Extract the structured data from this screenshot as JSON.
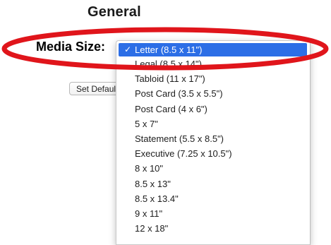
{
  "section": {
    "title": "General"
  },
  "field": {
    "label": "Media Size:"
  },
  "button": {
    "label": "Set Defaults"
  },
  "dropdown": {
    "selected_index": 0,
    "checkmark": "✓",
    "items": [
      {
        "label": "Letter (8.5 x 11\")"
      },
      {
        "label": "Legal (8.5 x 14\")"
      },
      {
        "label": "Tabloid (11 x 17\")"
      },
      {
        "label": "Post Card (3.5 x 5.5\")"
      },
      {
        "label": "Post Card (4 x 6\")"
      },
      {
        "label": "5 x 7\""
      },
      {
        "label": "Statement (5.5 x 8.5\")"
      },
      {
        "label": "Executive (7.25 x 10.5\")"
      },
      {
        "label": "8 x 10\""
      },
      {
        "label": "8.5 x 13\""
      },
      {
        "label": "8.5 x 13.4\""
      },
      {
        "label": "9 x 11\""
      },
      {
        "label": "12 x 18\""
      }
    ]
  },
  "colors": {
    "selection_highlight": "#2c6ee6",
    "annotation_ring": "#e0151b"
  }
}
